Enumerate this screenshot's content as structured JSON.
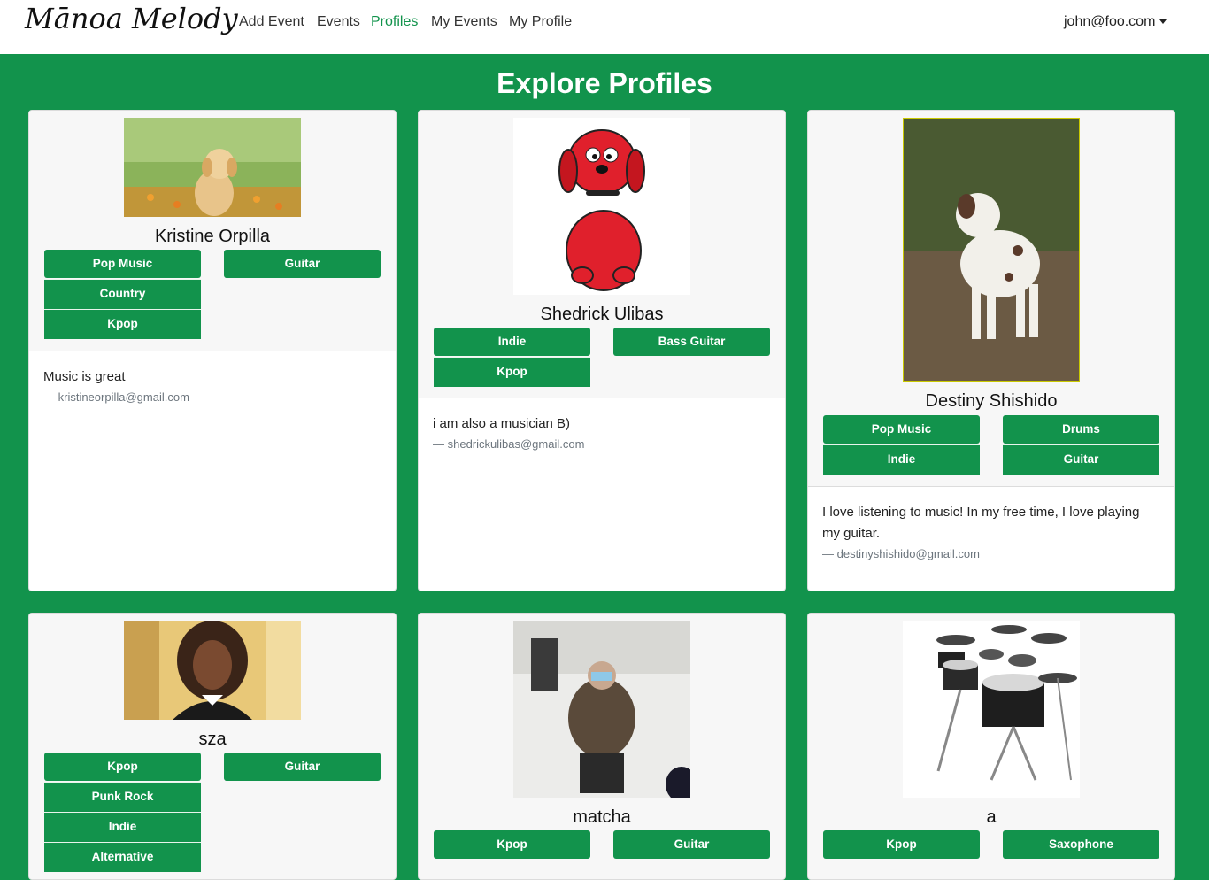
{
  "nav": {
    "brand": "Mānoa Melody",
    "links": [
      "Add Event",
      "Events",
      "Profiles",
      "My Events",
      "My Profile"
    ],
    "user": "john@foo.com"
  },
  "page": {
    "title": "Explore Profiles"
  },
  "profiles": [
    {
      "name": "Kristine Orpilla",
      "genres": [
        "Pop Music",
        "Country",
        "Kpop"
      ],
      "instruments": [
        "Guitar"
      ],
      "bio": "Music is great",
      "email": "— kristineorpilla@gmail.com"
    },
    {
      "name": "Shedrick Ulibas",
      "genres": [
        "Indie",
        "Kpop"
      ],
      "instruments": [
        "Bass Guitar"
      ],
      "bio": "i am also a musician B)",
      "email": "— shedrickulibas@gmail.com"
    },
    {
      "name": "Destiny Shishido",
      "genres": [
        "Pop Music",
        "Indie"
      ],
      "instruments": [
        "Drums",
        "Guitar"
      ],
      "bio": "I love listening to music! In my free time, I love playing my guitar.",
      "email": "— destinyshishido@gmail.com"
    },
    {
      "name": "sza",
      "genres": [
        "Kpop",
        "Punk Rock",
        "Indie",
        "Alternative"
      ],
      "instruments": [
        "Guitar"
      ]
    },
    {
      "name": "matcha",
      "genres": [
        "Kpop"
      ],
      "instruments": [
        "Guitar"
      ]
    },
    {
      "name": "a",
      "genres": [
        "Kpop"
      ],
      "instruments": [
        "Saxophone"
      ]
    }
  ],
  "colors": {
    "primary": "#12934c",
    "navbar": "#ffffff",
    "card_top": "#f7f7f7"
  }
}
